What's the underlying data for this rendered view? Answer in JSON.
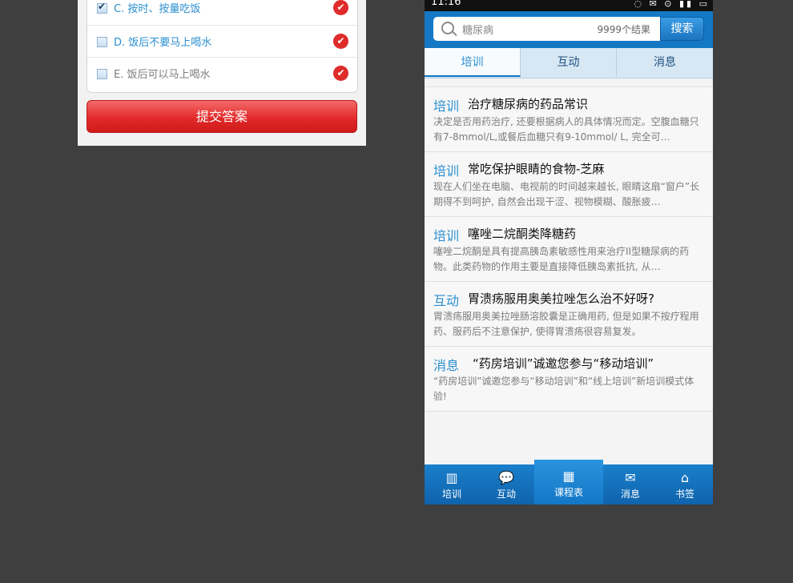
{
  "quiz": {
    "options": [
      {
        "label": "C. 按时、按量吃饭",
        "checked": true,
        "muted": false
      },
      {
        "label": "D. 饭后不要马上喝水",
        "checked": false,
        "muted": false
      },
      {
        "label": "E. 饭后可以马上喝水",
        "checked": false,
        "muted": true
      }
    ],
    "submit_label": "提交答案"
  },
  "phone": {
    "status": {
      "time": "11:16",
      "icons": "◌ ✉ ⊙ ▮▮ ▭"
    },
    "search": {
      "query": "糖尿病",
      "count": "9999个结果",
      "button": "搜索"
    },
    "tabs": [
      "培训",
      "互动",
      "消息"
    ],
    "items": [
      {
        "tag": "培训",
        "title": "治疗糖尿病的药品常识",
        "desc": "决定是否用药治疗, 还要根据病人的具体情况而定。空腹血糖只有7-8mmol/L,或餐后血糖只有9-10mmol/ L, 完全可…"
      },
      {
        "tag": "培训",
        "title": "常吃保护眼睛的食物-芝麻",
        "desc": "现在人们坐在电脑、电视前的时间越来越长, 眼睛这扇“窗户”长期得不到呵护, 自然会出现干涩、视物模糊、酸胀疲…"
      },
      {
        "tag": "培训",
        "title": "噻唑二烷酮类降糖药",
        "desc": "噻唑二烷酮是具有提高胰岛素敏感性用来治疗II型糖尿病的药物。此类药物的作用主要是直接降低胰岛素抵抗, 从…"
      },
      {
        "tag": "互动",
        "title": "胃溃疡服用奥美拉唑怎么治不好呀?",
        "desc": "胃溃疡服用奥美拉唑肠溶胶囊是正确用药, 但是如果不按疗程用药、服药后不注意保护, 使得胃溃疡很容易复发。"
      },
      {
        "tag": "消息",
        "title": "“药房培训”诚邀您参与“移动培训”",
        "desc": "“药房培训”诚邀您参与“移动培训”和“线上培训”新培训模式体验!"
      }
    ],
    "nav": [
      {
        "label": "培训",
        "icon": "book-icon",
        "glyph": "▥"
      },
      {
        "label": "互动",
        "icon": "chat-icon",
        "glyph": "💬"
      },
      {
        "label": "课程表",
        "icon": "calendar-icon",
        "glyph": "▦"
      },
      {
        "label": "消息",
        "icon": "mail-icon",
        "glyph": "✉"
      },
      {
        "label": "书签",
        "icon": "tag-icon",
        "glyph": "⌂"
      }
    ]
  }
}
